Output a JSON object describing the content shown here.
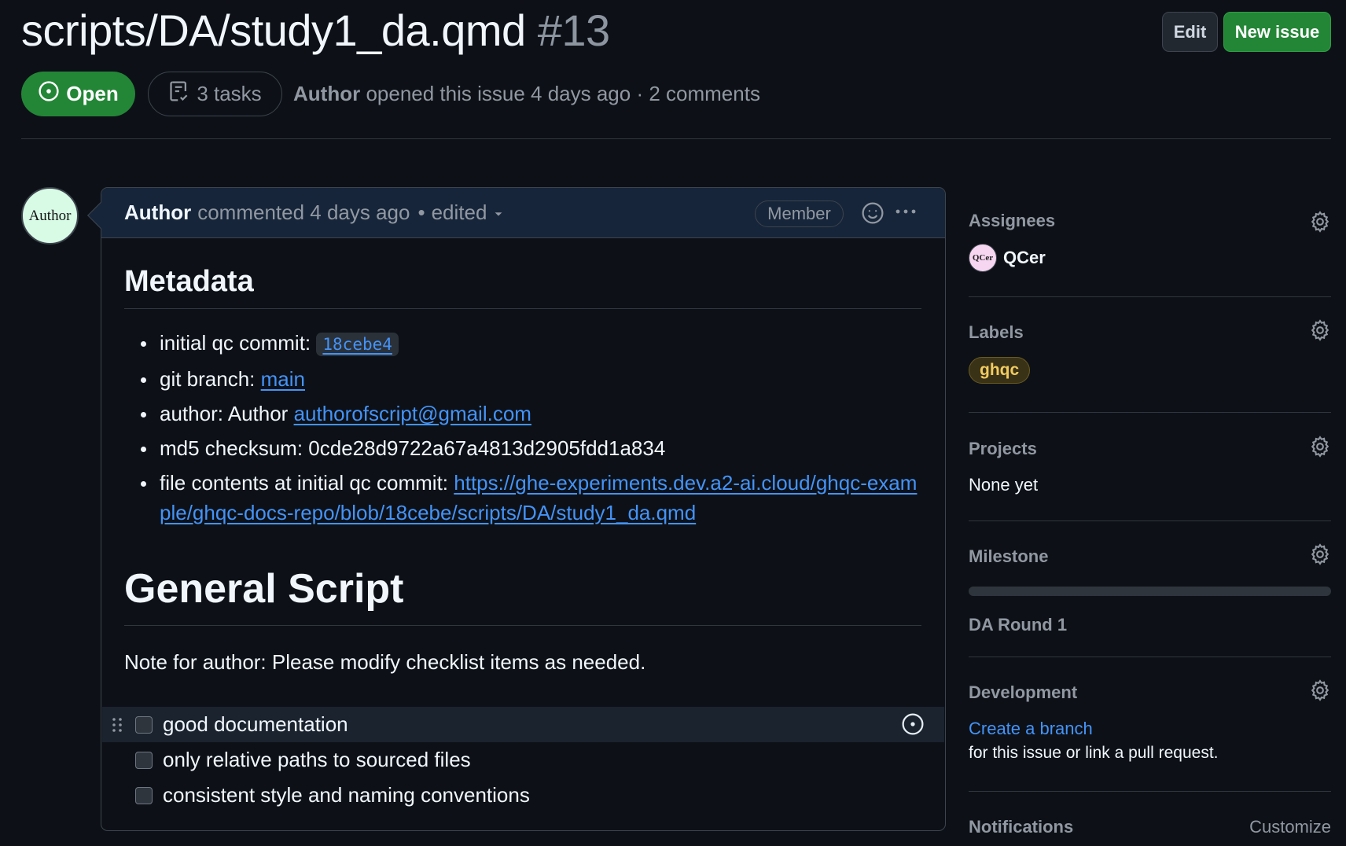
{
  "issue": {
    "title": "scripts/DA/study1_da.qmd",
    "number": "#13",
    "state": "Open",
    "tasks": "3 tasks",
    "author": "Author",
    "opened_text": "opened this issue 4 days ago · 2 comments"
  },
  "header_buttons": {
    "edit": "Edit",
    "new_issue": "New issue"
  },
  "comment": {
    "avatar_text": "Author",
    "author": "Author",
    "action": "commented 4 days ago",
    "separator": "•",
    "edited": "edited",
    "role_badge": "Member"
  },
  "body": {
    "metadata_heading": "Metadata",
    "items": [
      {
        "label": "initial qc commit: ",
        "code": "18cebe4"
      },
      {
        "label": "git branch: ",
        "link": "main"
      },
      {
        "label": "author: Author ",
        "link": "authorofscript@gmail.com"
      },
      {
        "label": "md5 checksum: 0cde28d9722a67a4813d2905fdd1a834"
      },
      {
        "label": "file contents at initial qc commit: ",
        "link": "https://ghe-experiments.dev.a2-ai.cloud/ghqc-example/ghqc-docs-repo/blob/18cebe/scripts/DA/study1_da.qmd"
      }
    ],
    "general_heading": "General Script",
    "note": "Note for author: Please modify checklist items as needed.",
    "tasks": [
      {
        "label": "good documentation",
        "checked": false
      },
      {
        "label": "only relative paths to sourced files",
        "checked": false
      },
      {
        "label": "consistent style and naming conventions",
        "checked": false
      }
    ]
  },
  "sidebar": {
    "assignees": {
      "heading": "Assignees",
      "avatar_text": "QCer",
      "name": "QCer"
    },
    "labels": {
      "heading": "Labels",
      "items": [
        "ghqc"
      ],
      "label_color": "#f2cc60"
    },
    "projects": {
      "heading": "Projects",
      "value": "None yet"
    },
    "milestone": {
      "heading": "Milestone",
      "name": "DA Round 1",
      "progress": 0
    },
    "development": {
      "heading": "Development",
      "link": "Create a branch",
      "text": "for this issue or link a pull request."
    },
    "notifications": {
      "heading": "Notifications",
      "action": "Customize"
    }
  },
  "colors": {
    "open_green": "#238636",
    "link_blue": "#4493f8",
    "background": "#0d1117"
  }
}
